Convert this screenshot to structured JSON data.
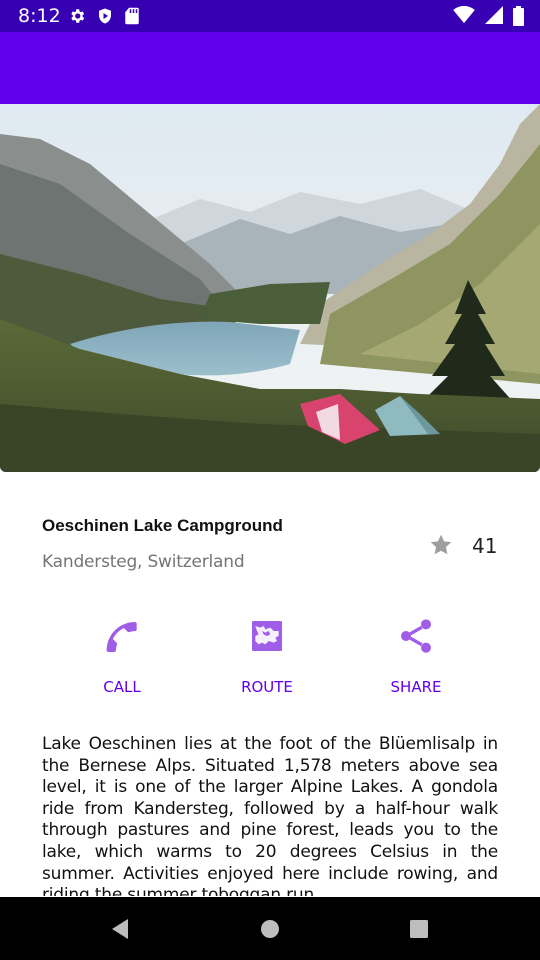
{
  "status_bar": {
    "time": "8:12",
    "left_icons": [
      "settings-gear-icon",
      "play-protect-icon",
      "sd-card-icon"
    ],
    "right_icons": [
      "wifi-icon",
      "signal-icon",
      "battery-icon"
    ]
  },
  "colors": {
    "status_bar": "#3700b3",
    "app_bar": "#6200ee",
    "accent": "#6200ee",
    "action_icon": "#a05ee8"
  },
  "place": {
    "title": "Oeschinen Lake Campground",
    "location": "Kandersteg, Switzerland",
    "star_count": "41"
  },
  "actions": [
    {
      "label": "CALL",
      "icon": "phone-icon"
    },
    {
      "label": "ROUTE",
      "icon": "map-icon"
    },
    {
      "label": "SHARE",
      "icon": "share-icon"
    }
  ],
  "description": "Lake Oeschinen lies at the foot of the Blüemlisalp in the Bernese Alps. Situated 1,578 meters above sea level, it is one of the larger Alpine Lakes. A gondola ride from Kandersteg, followed by a half-hour walk through pastures and pine forest, leads you to the lake, which warms to 20 degrees Celsius in the summer. Activities enjoyed here include rowing, and riding the summer toboggan run.",
  "nav_bar": [
    "back-icon",
    "home-icon",
    "recents-icon"
  ]
}
